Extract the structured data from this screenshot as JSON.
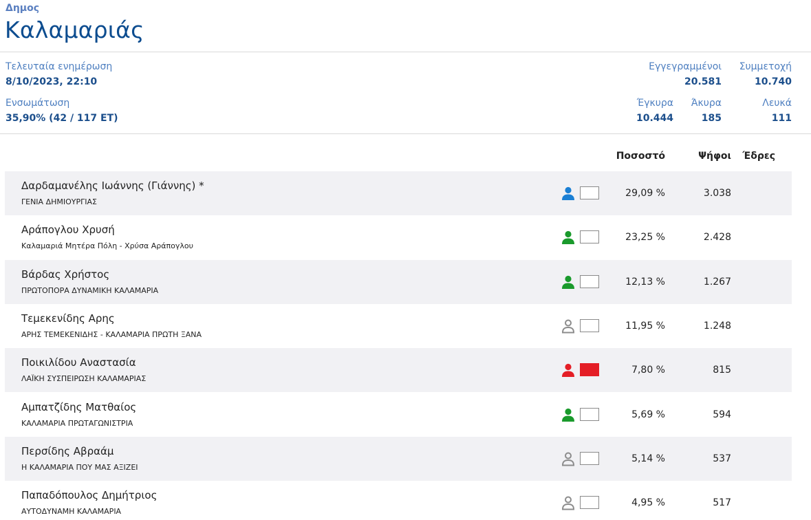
{
  "header": {
    "category": "Δημος",
    "name": "Καλαμαριάς"
  },
  "stats": {
    "last_update_label": "Τελευταία ενημέρωση",
    "last_update_value": "8/10/2023, 22:10",
    "integration_label": "Ενσωμάτωση",
    "integration_value": "35,90% (42 / 117 ΕΤ)",
    "registered_label": "Εγγεγραμμένοι",
    "registered_value": "20.581",
    "turnout_label": "Συμμετοχή",
    "turnout_value": "10.740",
    "valid_label": "Έγκυρα",
    "valid_value": "10.444",
    "invalid_label": "Άκυρα",
    "invalid_value": "185",
    "blank_label": "Λευκά",
    "blank_value": "111"
  },
  "columns": {
    "percent": "Ποσοστό",
    "votes": "Ψήφοι",
    "seats": "Έδρες"
  },
  "candidates": [
    {
      "name": "Δαρδαμανέλης Ιωάννης (Γιάννης) *",
      "party": "ΓΕΝΙΑ ΔΗΜΙΟΥΡΓΙΑΣ",
      "percent": "29,09 %",
      "votes": "3.038",
      "icon": "person-icon",
      "icon_color": "#1a7fd4",
      "box_filled": false
    },
    {
      "name": "Αράπογλου Χρυσή",
      "party": "Καλαμαριά Μητέρα Πόλη - Χρύσα Αράπογλου",
      "percent": "23,25 %",
      "votes": "2.428",
      "icon": "person-icon",
      "icon_color": "#1a9a2c",
      "box_filled": false
    },
    {
      "name": "Βάρδας Χρήστος",
      "party": "ΠΡΩΤΟΠΟΡΑ ΔΥΝΑΜΙΚΗ ΚΑΛΑΜΑΡΙΑ",
      "percent": "12,13 %",
      "votes": "1.267",
      "icon": "person-icon",
      "icon_color": "#1a9a2c",
      "box_filled": false
    },
    {
      "name": "Τεμεκενίδης Αρης",
      "party": "ΑΡΗΣ ΤΕΜΕΚΕΝΙΔΗΣ - ΚΑΛΑΜΑΡΙΑ ΠΡΩΤΗ ΞΑΝΑ",
      "percent": "11,95 %",
      "votes": "1.248",
      "icon": "person-outline-icon",
      "icon_color": "#8c8c8c",
      "box_filled": false
    },
    {
      "name": "Ποικιλίδου Αναστασία",
      "party": "ΛΑΪΚΗ ΣΥΣΠΕΙΡΩΣΗ ΚΑΛΑΜΑΡΙΑΣ",
      "percent": "7,80 %",
      "votes": "815",
      "icon": "person-icon",
      "icon_color": "#e41e26",
      "box_filled": true
    },
    {
      "name": "Αμπατζίδης Ματθαίος",
      "party": "ΚΑΛΑΜΑΡΙΑ ΠΡΩΤΑΓΩΝΙΣΤΡΙΑ",
      "percent": "5,69 %",
      "votes": "594",
      "icon": "person-icon",
      "icon_color": "#1a9a2c",
      "box_filled": false
    },
    {
      "name": "Περσίδης Αβραάμ",
      "party": "Η ΚΑΛΑΜΑΡΙΑ ΠΟΥ ΜΑΣ ΑΞΙΖΕΙ",
      "percent": "5,14 %",
      "votes": "537",
      "icon": "person-outline-icon",
      "icon_color": "#8c8c8c",
      "box_filled": false
    },
    {
      "name": "Παπαδόπουλος Δημήτριος",
      "party": "ΑΥΤΟΔΥΝΑΜΗ ΚΑΛΑΜΑΡΙΑ",
      "percent": "4,95 %",
      "votes": "517",
      "icon": "person-outline-icon",
      "icon_color": "#8c8c8c",
      "box_filled": false
    }
  ]
}
